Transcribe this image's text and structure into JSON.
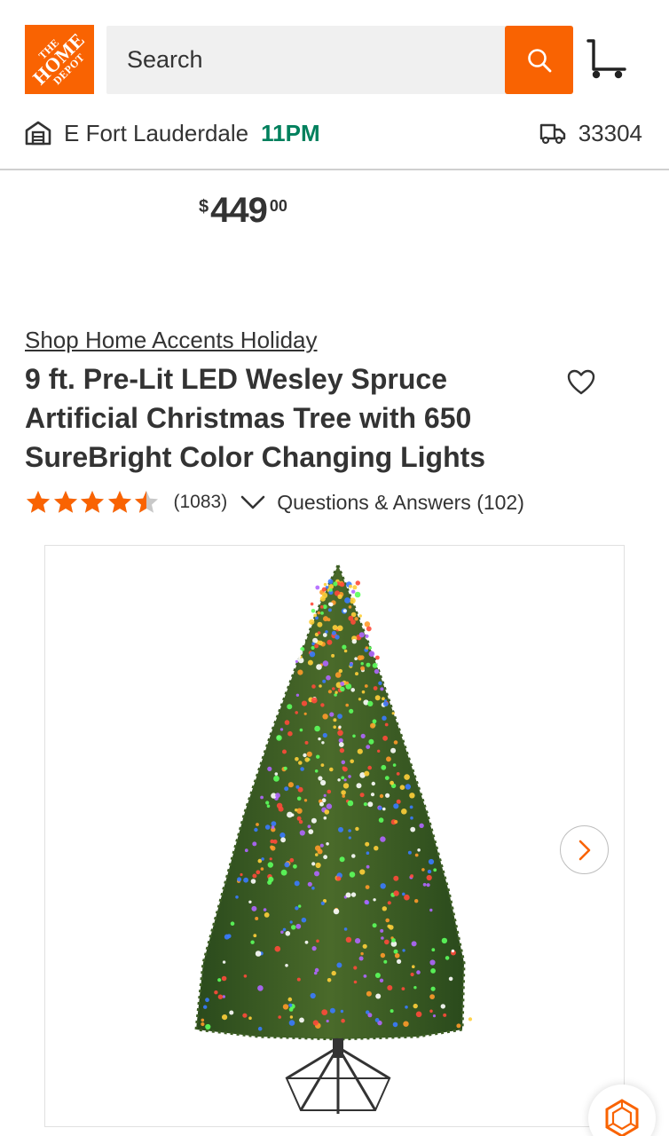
{
  "header": {
    "logo": {
      "line1": "THE",
      "line2": "HOME",
      "line3": "DEPOT"
    },
    "search": {
      "placeholder": "Search"
    },
    "store": {
      "name": "E Fort Lauderdale",
      "hours": "11PM"
    },
    "delivery": {
      "zip": "33304"
    }
  },
  "product": {
    "price": {
      "currency": "$",
      "whole": "449",
      "cents": "00"
    },
    "brand_link": "Shop Home Accents Holiday",
    "title": "9 ft. Pre-Lit LED Wesley Spruce Artificial Christmas Tree with 650 SureBright Color Changing Lights",
    "rating": {
      "stars": 4.5,
      "review_count": "(1083)"
    },
    "qa_link": "Questions & Answers (102)"
  },
  "gallery": {
    "icons": {
      "next": "chevron-right-icon"
    }
  },
  "colors": {
    "brand_orange": "#f96302",
    "store_hours_green": "#00805d",
    "text": "#333333"
  }
}
